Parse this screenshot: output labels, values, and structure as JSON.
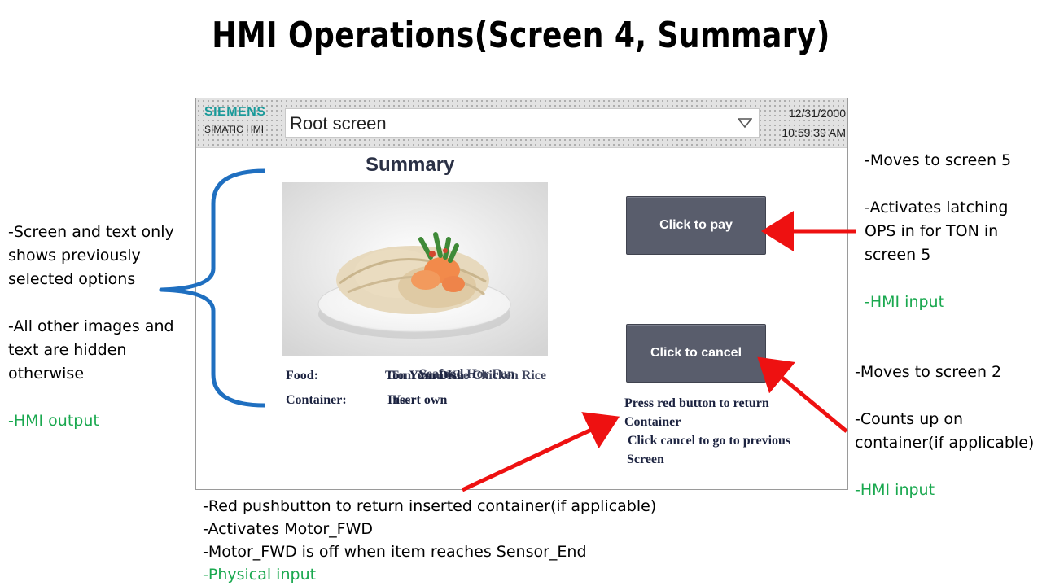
{
  "slide_title": "HMI Operations(Screen 4, Summary)",
  "hmi": {
    "brand_siemens": "SIEMENS",
    "brand_simatic": "SIMATIC HMI",
    "screen_selector": "Root screen",
    "date": "12/31/2000",
    "time": "10:59:39 AM",
    "summary_title": "Summary",
    "food_label": "Food:",
    "food_value": "Ton Yum Dish",
    "food_overlay": "Tom Yum Kee Chicken Rice",
    "food_overlay2": "Seafood Hor Fun",
    "container_label": "Container:",
    "container_value": "Insert own",
    "container_overlay": "Yes",
    "pay_button": "Click to pay",
    "cancel_button": "Click to cancel",
    "instructions": [
      "Press red button to return",
      "Container",
      " Click cancel to go to previous",
      "Screen"
    ]
  },
  "left_annotation": {
    "lines": [
      "-Screen and text only",
      "shows previously",
      "selected options"
    ],
    "lines2": [
      "-All other images and",
      "text are hidden",
      "otherwise"
    ],
    "tag": "-HMI output"
  },
  "right_top_annotation": {
    "line1": "-Moves to screen 5",
    "lines": [
      "-Activates latching",
      "OPS in for TON in",
      "screen 5"
    ],
    "tag": "-HMI input"
  },
  "right_bottom_annotation": {
    "line1": "-Moves to screen 2",
    "lines": [
      "-Counts up on",
      "container(if applicable)"
    ],
    "tag": "-HMI input"
  },
  "bottom_annotation": {
    "lines": [
      "-Red pushbutton to return inserted container(if applicable)",
      "-Activates Motor_FWD",
      "-Motor_FWD is off when item reaches Sensor_End"
    ],
    "tag": "-Physical input"
  },
  "colors": {
    "arrow": "#ee1111",
    "brace": "#1f6fc0",
    "tag_green": "#1aa84f",
    "button": "#595d6c",
    "siemens": "#1a9a9a"
  }
}
